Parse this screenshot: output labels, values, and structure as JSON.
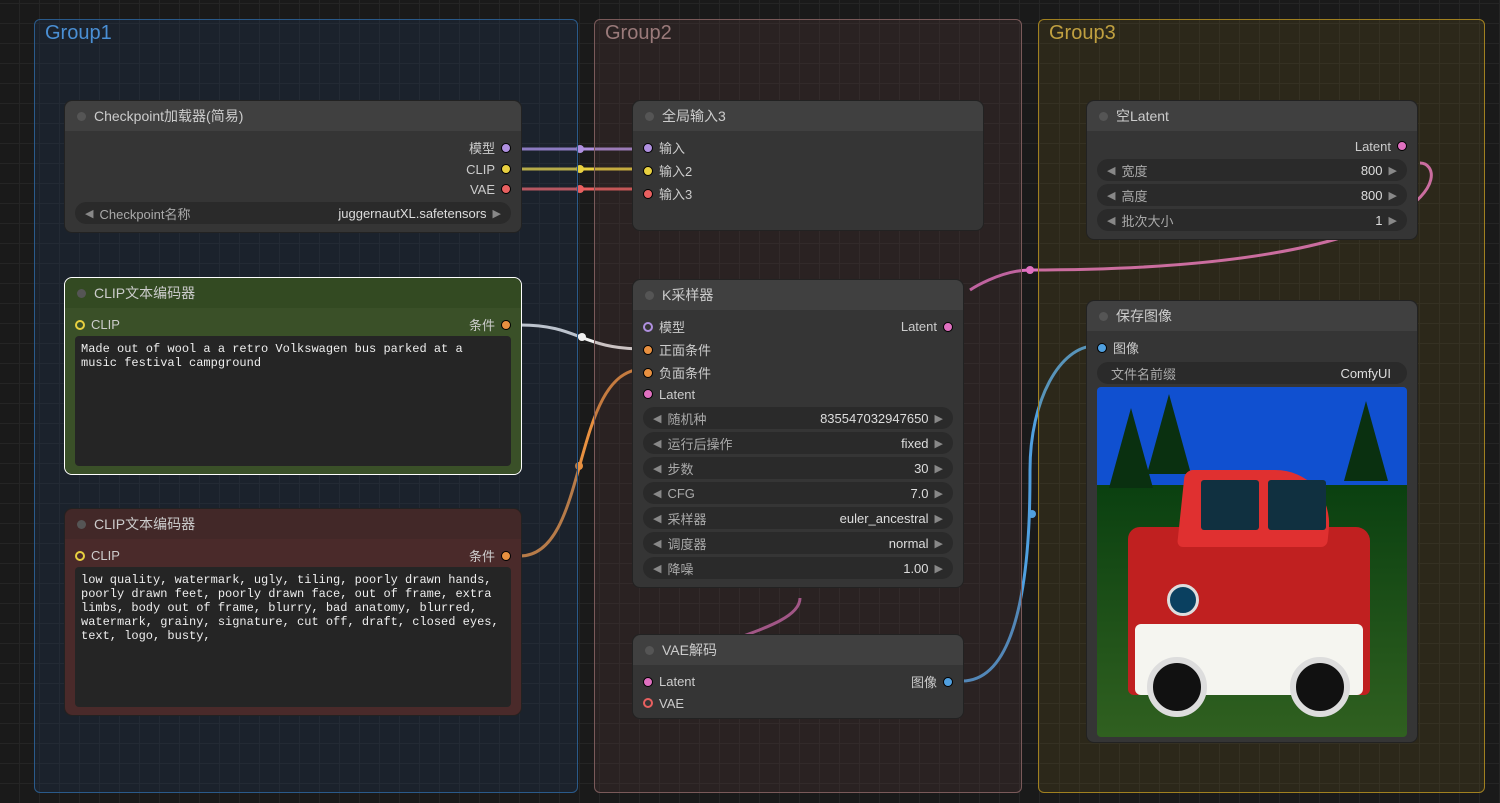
{
  "groups": {
    "g1": "Group1",
    "g2": "Group2",
    "g3": "Group3"
  },
  "checkpoint": {
    "title": "Checkpoint加载器(简易)",
    "out_model": "模型",
    "out_clip": "CLIP",
    "out_vae": "VAE",
    "widget_label": "Checkpoint名称",
    "widget_value": "juggernautXL.safetensors"
  },
  "clip_pos": {
    "title": "CLIP文本编码器",
    "in_clip": "CLIP",
    "out_cond": "条件",
    "text": "Made out of wool a a retro Volkswagen bus parked at a music festival campground"
  },
  "clip_neg": {
    "title": "CLIP文本编码器",
    "in_clip": "CLIP",
    "out_cond": "条件",
    "text": "low quality, watermark, ugly, tiling, poorly drawn hands, poorly drawn feet, poorly drawn face, out of frame, extra limbs, body out of frame, blurry, bad anatomy, blurred, watermark, grainy, signature, cut off, draft, closed eyes, text, logo, busty,"
  },
  "reroute": {
    "title": "全局输入3",
    "in1": "输入",
    "in2": "输入2",
    "in3": "输入3"
  },
  "ksampler": {
    "title": "K采样器",
    "in_model": "模型",
    "in_pos": "正面条件",
    "in_neg": "负面条件",
    "in_latent": "Latent",
    "out_latent": "Latent",
    "seed_label": "随机种",
    "seed_value": "835547032947650",
    "control_label": "运行后操作",
    "control_value": "fixed",
    "steps_label": "步数",
    "steps_value": "30",
    "cfg_label": "CFG",
    "cfg_value": "7.0",
    "sampler_label": "采样器",
    "sampler_value": "euler_ancestral",
    "scheduler_label": "调度器",
    "scheduler_value": "normal",
    "denoise_label": "降噪",
    "denoise_value": "1.00"
  },
  "vae_decode": {
    "title": "VAE解码",
    "in_latent": "Latent",
    "in_vae": "VAE",
    "out_image": "图像"
  },
  "empty_latent": {
    "title": "空Latent",
    "out_latent": "Latent",
    "width_label": "宽度",
    "width_value": "800",
    "height_label": "高度",
    "height_value": "800",
    "batch_label": "批次大小",
    "batch_value": "1"
  },
  "save_image": {
    "title": "保存图像",
    "in_image": "图像",
    "prefix_label": "文件名前缀",
    "prefix_value": "ComfyUI"
  },
  "colors": {
    "model": "#b090e0",
    "clip": "#e8d040",
    "vae": "#e86060",
    "cond": "#e89040",
    "latent": "#e070c0",
    "image": "#50a0e0"
  }
}
